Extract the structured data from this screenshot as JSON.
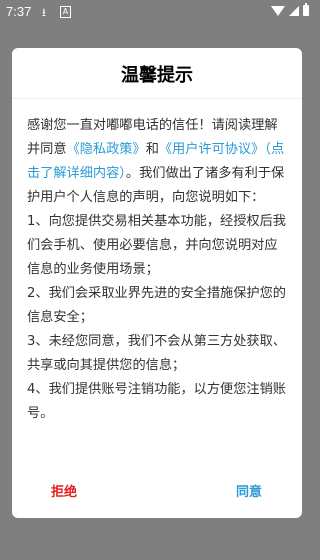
{
  "status_bar": {
    "time": "7:37",
    "download_icon": "download-icon",
    "a_icon": "A",
    "right_icons": [
      "wifi-icon",
      "signal-icon",
      "battery-icon"
    ]
  },
  "dialog": {
    "title": "温馨提示",
    "body": {
      "p1_a": "感谢您一直对嘟嘟电话的信任！请阅读理解并同意",
      "link_privacy": "《隐私政策》",
      "p1_b": "和",
      "link_user": "《用户许可协议》",
      "link_click": "（点击了解详细内容）",
      "p1_c": "。我们做出了诸多有利于保护用户个人信息的声明，向您说明如下：",
      "item1": "1、向您提供交易相关基本功能，经授权后我们会手机、使用必要信息，并向您说明对应信息的业务使用场景；",
      "item2": "2、我们会采取业界先进的安全措施保护您的信息安全；",
      "item3": "3、未经您同意，我们不会从第三方处获取、共享或向其提供您的信息；",
      "item4": "4、我们提供账号注销功能，以方便您注销账号。"
    },
    "reject_label": "拒绝",
    "agree_label": "同意"
  },
  "colors": {
    "link": "#2a9bd8",
    "reject": "#e52020",
    "overlay": "#7f7f7f"
  }
}
